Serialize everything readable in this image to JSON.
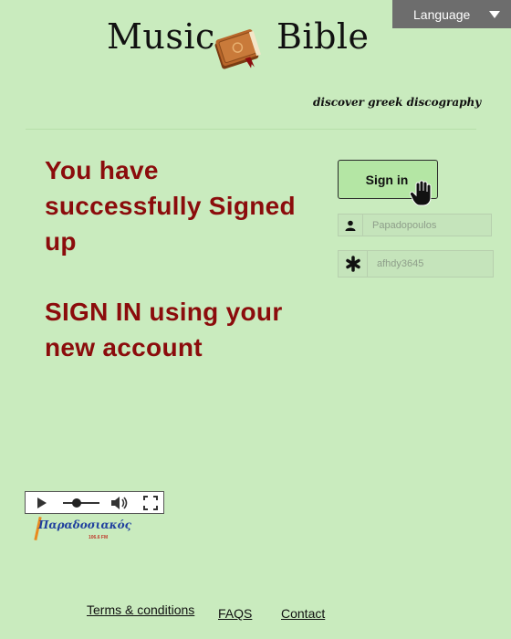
{
  "language": {
    "label": "Language"
  },
  "logo": {
    "left": "Music",
    "right": "Bible",
    "tagline": "discover greek discography"
  },
  "message": {
    "line1": "You have successfully Signed up",
    "line2": "SIGN IN  using your new account"
  },
  "signin": {
    "button_label": "Sign in"
  },
  "fields": {
    "username_value": "Papadopoulos",
    "password_value": "afhdy3645"
  },
  "radio": {
    "station_name": "Παραδοσιακός",
    "station_freq": "106.6 FM"
  },
  "footer": {
    "terms": "Terms & conditions",
    "faqs": "FAQS",
    "contact": "Contact"
  },
  "colors": {
    "background": "#c9ebbe",
    "message": "#8b0c0c",
    "button": "#b4e6a4",
    "language_bar": "#6d6d6d"
  }
}
